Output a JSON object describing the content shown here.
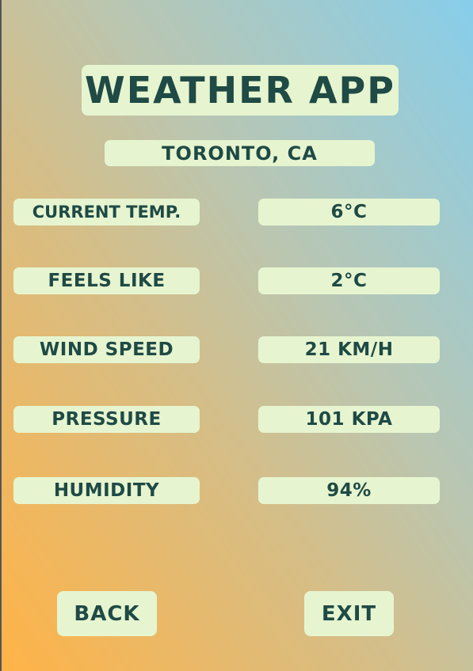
{
  "app": {
    "title": "Weather App",
    "location": "Toronto, CA"
  },
  "rows": [
    {
      "label": "Current Temp.",
      "value": "6°C"
    },
    {
      "label": "Feels Like",
      "value": "2°C"
    },
    {
      "label": "Wind Speed",
      "value": "21 km/h"
    },
    {
      "label": "Pressure",
      "value": "101 kPa"
    },
    {
      "label": "Humidity",
      "value": "94%"
    }
  ],
  "buttons": {
    "back": "Back",
    "exit": "Exit"
  },
  "colors": {
    "pill_background": "#E6F5D0",
    "text": "#1F4A45",
    "gradient_bottom_left": "#FFB347",
    "gradient_top_right": "#87CEEB"
  }
}
